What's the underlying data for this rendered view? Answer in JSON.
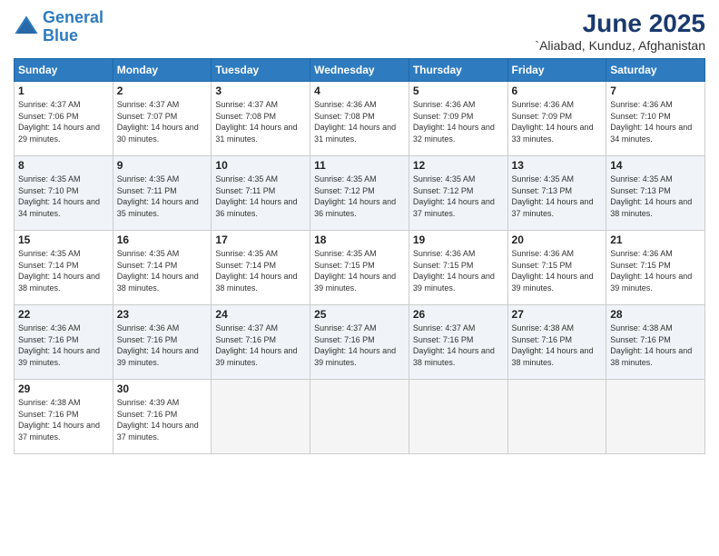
{
  "header": {
    "logo_line1": "General",
    "logo_line2": "Blue",
    "month": "June 2025",
    "location": "`Aliabad, Kunduz, Afghanistan"
  },
  "weekdays": [
    "Sunday",
    "Monday",
    "Tuesday",
    "Wednesday",
    "Thursday",
    "Friday",
    "Saturday"
  ],
  "weeks": [
    [
      {
        "day": "1",
        "sunrise": "4:37 AM",
        "sunset": "7:06 PM",
        "daylight": "14 hours and 29 minutes."
      },
      {
        "day": "2",
        "sunrise": "4:37 AM",
        "sunset": "7:07 PM",
        "daylight": "14 hours and 30 minutes."
      },
      {
        "day": "3",
        "sunrise": "4:37 AM",
        "sunset": "7:08 PM",
        "daylight": "14 hours and 31 minutes."
      },
      {
        "day": "4",
        "sunrise": "4:36 AM",
        "sunset": "7:08 PM",
        "daylight": "14 hours and 31 minutes."
      },
      {
        "day": "5",
        "sunrise": "4:36 AM",
        "sunset": "7:09 PM",
        "daylight": "14 hours and 32 minutes."
      },
      {
        "day": "6",
        "sunrise": "4:36 AM",
        "sunset": "7:09 PM",
        "daylight": "14 hours and 33 minutes."
      },
      {
        "day": "7",
        "sunrise": "4:36 AM",
        "sunset": "7:10 PM",
        "daylight": "14 hours and 34 minutes."
      }
    ],
    [
      {
        "day": "8",
        "sunrise": "4:35 AM",
        "sunset": "7:10 PM",
        "daylight": "14 hours and 34 minutes."
      },
      {
        "day": "9",
        "sunrise": "4:35 AM",
        "sunset": "7:11 PM",
        "daylight": "14 hours and 35 minutes."
      },
      {
        "day": "10",
        "sunrise": "4:35 AM",
        "sunset": "7:11 PM",
        "daylight": "14 hours and 36 minutes."
      },
      {
        "day": "11",
        "sunrise": "4:35 AM",
        "sunset": "7:12 PM",
        "daylight": "14 hours and 36 minutes."
      },
      {
        "day": "12",
        "sunrise": "4:35 AM",
        "sunset": "7:12 PM",
        "daylight": "14 hours and 37 minutes."
      },
      {
        "day": "13",
        "sunrise": "4:35 AM",
        "sunset": "7:13 PM",
        "daylight": "14 hours and 37 minutes."
      },
      {
        "day": "14",
        "sunrise": "4:35 AM",
        "sunset": "7:13 PM",
        "daylight": "14 hours and 38 minutes."
      }
    ],
    [
      {
        "day": "15",
        "sunrise": "4:35 AM",
        "sunset": "7:14 PM",
        "daylight": "14 hours and 38 minutes."
      },
      {
        "day": "16",
        "sunrise": "4:35 AM",
        "sunset": "7:14 PM",
        "daylight": "14 hours and 38 minutes."
      },
      {
        "day": "17",
        "sunrise": "4:35 AM",
        "sunset": "7:14 PM",
        "daylight": "14 hours and 38 minutes."
      },
      {
        "day": "18",
        "sunrise": "4:35 AM",
        "sunset": "7:15 PM",
        "daylight": "14 hours and 39 minutes."
      },
      {
        "day": "19",
        "sunrise": "4:36 AM",
        "sunset": "7:15 PM",
        "daylight": "14 hours and 39 minutes."
      },
      {
        "day": "20",
        "sunrise": "4:36 AM",
        "sunset": "7:15 PM",
        "daylight": "14 hours and 39 minutes."
      },
      {
        "day": "21",
        "sunrise": "4:36 AM",
        "sunset": "7:15 PM",
        "daylight": "14 hours and 39 minutes."
      }
    ],
    [
      {
        "day": "22",
        "sunrise": "4:36 AM",
        "sunset": "7:16 PM",
        "daylight": "14 hours and 39 minutes."
      },
      {
        "day": "23",
        "sunrise": "4:36 AM",
        "sunset": "7:16 PM",
        "daylight": "14 hours and 39 minutes."
      },
      {
        "day": "24",
        "sunrise": "4:37 AM",
        "sunset": "7:16 PM",
        "daylight": "14 hours and 39 minutes."
      },
      {
        "day": "25",
        "sunrise": "4:37 AM",
        "sunset": "7:16 PM",
        "daylight": "14 hours and 39 minutes."
      },
      {
        "day": "26",
        "sunrise": "4:37 AM",
        "sunset": "7:16 PM",
        "daylight": "14 hours and 38 minutes."
      },
      {
        "day": "27",
        "sunrise": "4:38 AM",
        "sunset": "7:16 PM",
        "daylight": "14 hours and 38 minutes."
      },
      {
        "day": "28",
        "sunrise": "4:38 AM",
        "sunset": "7:16 PM",
        "daylight": "14 hours and 38 minutes."
      }
    ],
    [
      {
        "day": "29",
        "sunrise": "4:38 AM",
        "sunset": "7:16 PM",
        "daylight": "14 hours and 37 minutes."
      },
      {
        "day": "30",
        "sunrise": "4:39 AM",
        "sunset": "7:16 PM",
        "daylight": "14 hours and 37 minutes."
      },
      null,
      null,
      null,
      null,
      null
    ]
  ]
}
